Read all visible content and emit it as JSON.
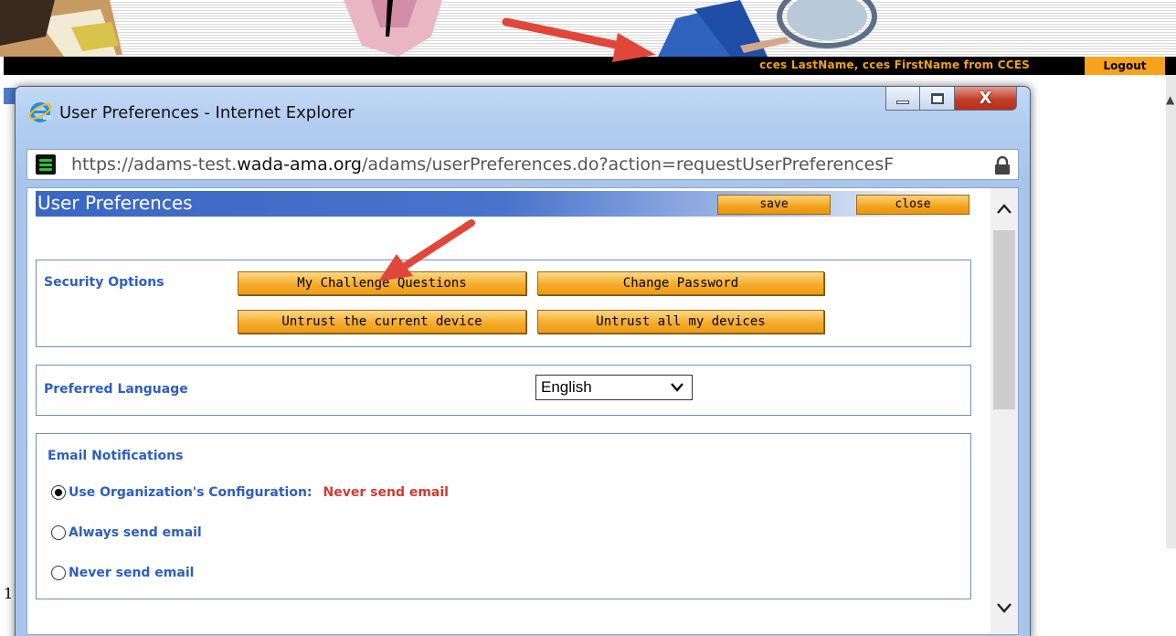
{
  "background_page": {
    "user_info": "cces  LastName,  cces  FirstName  from CCES",
    "logout_label": "Logout"
  },
  "browser": {
    "window_title": "User Preferences - Internet Explorer",
    "url_scheme": "https://",
    "url_prefix": "adams-test.",
    "url_host": "wada-ama.org",
    "url_path": "/adams/userPreferences.do?action=requestUserPreferencesF",
    "icons": {
      "browser": "internet-explorer-icon",
      "site": "site-favicon-icon",
      "lock": "lock-icon"
    }
  },
  "page": {
    "title": "User Preferences",
    "save_label": "save",
    "close_label": "close",
    "security": {
      "label": "Security Options",
      "buttons": [
        "My Challenge Questions",
        "Change Password",
        "Untrust the current device",
        "Untrust all my devices"
      ]
    },
    "language": {
      "label": "Preferred Language",
      "selected": "English"
    },
    "email": {
      "label": "Email Notifications",
      "options": [
        {
          "label": "Use Organization's Configuration:",
          "value": "Never send email",
          "selected": true
        },
        {
          "label": "Always send email",
          "selected": false
        },
        {
          "label": "Never send email",
          "selected": false
        }
      ]
    }
  },
  "colors": {
    "accent_orange": "#f2a31c",
    "label_blue": "#2d5ebf",
    "warning_red": "#d13a32",
    "annotation_arrow": "#e0473a"
  }
}
